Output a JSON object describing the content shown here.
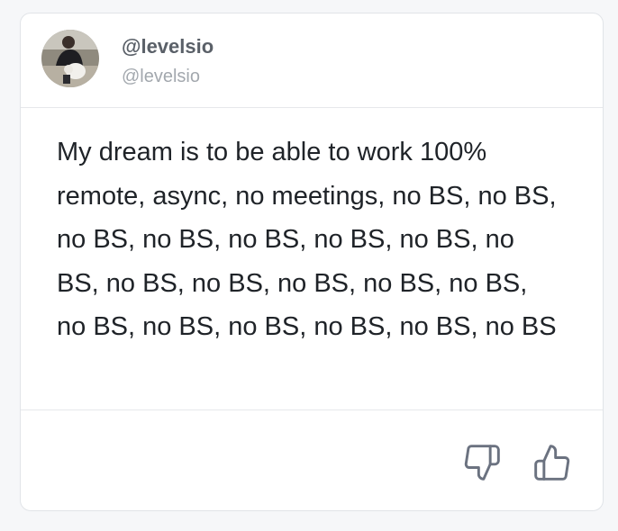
{
  "tweet": {
    "display_name": "@levelsio",
    "handle": "@levelsio",
    "text": "My dream is to be able to work 100% remote, async, no meetings, no BS, no BS, no BS, no BS, no BS, no BS, no BS, no BS, no BS, no BS, no BS, no BS, no BS, no BS, no BS, no BS, no BS, no BS, no BS"
  },
  "actions": {
    "thumbs_down_icon": "thumbs-down-icon",
    "thumbs_up_icon": "thumbs-up-icon"
  },
  "colors": {
    "icon": "#6b7280",
    "border": "#e1e4e8"
  }
}
